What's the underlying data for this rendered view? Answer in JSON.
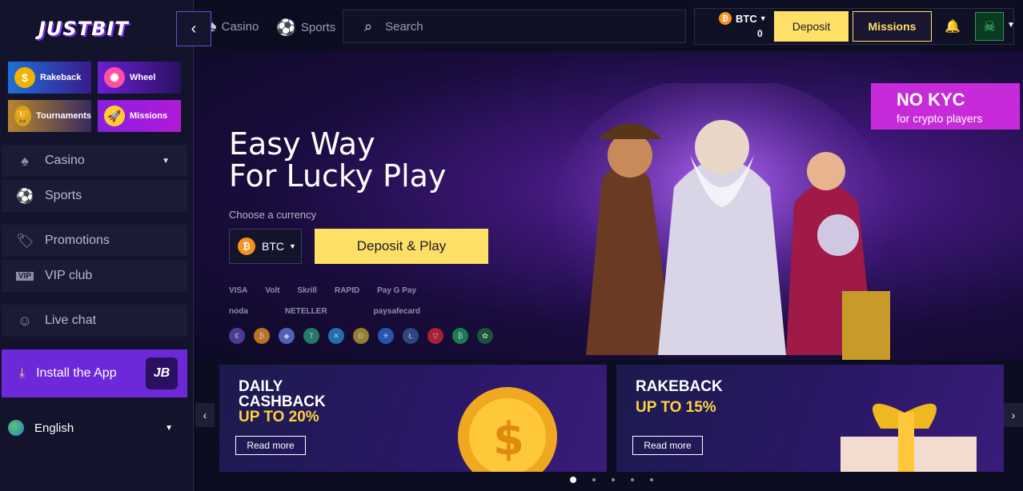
{
  "brand": {
    "logo": "JUSTBIT"
  },
  "sidebar": {
    "promo_tiles": [
      {
        "label": "Rakeback",
        "icon": "rakeback-icon",
        "color": "#1e6fd9"
      },
      {
        "label": "Wheel",
        "icon": "wheel-icon",
        "color": "#6a1fd6"
      },
      {
        "label": "Tournaments",
        "icon": "trophy-icon",
        "color": "#b8862d"
      },
      {
        "label": "Missions",
        "icon": "rocket-icon",
        "color": "#8a1fe0"
      }
    ],
    "nav": [
      {
        "label": "Casino",
        "icon": "spade-icon"
      },
      {
        "label": "Sports",
        "icon": "soccer-ball-icon"
      },
      {
        "label": "Promotions",
        "icon": "tag-icon"
      },
      {
        "label": "VIP club",
        "icon": "vip-icon"
      },
      {
        "label": "Live chat",
        "icon": "headset-icon"
      }
    ],
    "install": {
      "label": "Install the App",
      "badge": "JB"
    },
    "language": "English"
  },
  "topbar": {
    "casino": "Casino",
    "sports": "Sports",
    "search_placeholder": "Search",
    "currency": "BTC",
    "balance": "0",
    "deposit": "Deposit",
    "missions": "Missions"
  },
  "hero": {
    "title_line1": "Easy Way",
    "title_line2": "For Lucky Play",
    "choose_currency": "Choose a currency",
    "currency": "BTC",
    "cta": "Deposit & Play",
    "payments_row1": [
      "VISA",
      "Volt",
      "Skrill",
      "RAPID",
      "Pay G Pay"
    ],
    "payments_row2": [
      "noda",
      "NETELLER",
      "paysafecard"
    ],
    "badge_title": "NO KYC",
    "badge_sub": "for crypto players"
  },
  "promo_cards": [
    {
      "line1": "DAILY",
      "line2": "CASHBACK",
      "line3": "UP TO 20%",
      "cta": "Read more"
    },
    {
      "line1": "RAKEBACK",
      "line2": "",
      "line3": "UP TO 15%",
      "cta": "Read more"
    }
  ],
  "colors": {
    "accent": "#ffe066",
    "purple": "#6d28d9",
    "bg": "#0d0d22"
  }
}
